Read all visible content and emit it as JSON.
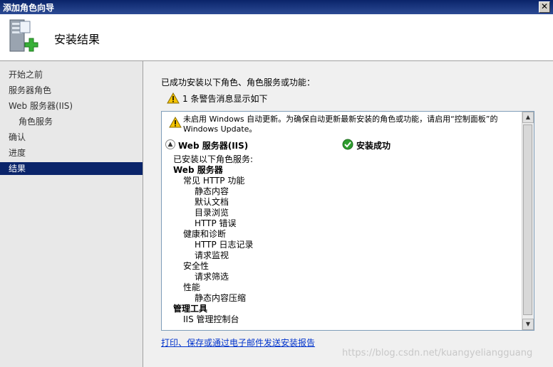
{
  "window": {
    "title": "添加角色向导",
    "close_glyph": "✕"
  },
  "header": {
    "title": "安装结果",
    "icon": "server-add-icon"
  },
  "sidebar": {
    "items": [
      {
        "label": "开始之前",
        "indent": 0,
        "selected": false
      },
      {
        "label": "服务器角色",
        "indent": 0,
        "selected": false
      },
      {
        "label": "Web 服务器(IIS)",
        "indent": 0,
        "selected": false
      },
      {
        "label": "角色服务",
        "indent": 1,
        "selected": false
      },
      {
        "label": "确认",
        "indent": 0,
        "selected": false
      },
      {
        "label": "进度",
        "indent": 0,
        "selected": false
      },
      {
        "label": "结果",
        "indent": 0,
        "selected": true
      }
    ]
  },
  "main": {
    "summary": "已成功安装以下角色、角色服务或功能：",
    "warning_count_text": "1 条警告消息显示如下",
    "results": {
      "note_text": "未启用 Windows 自动更新。为确保自动更新最新安装的角色或功能，请启用“控制面板”的 Windows Update。",
      "section_name": "Web 服务器(IIS)",
      "section_status": "安装成功",
      "tree": [
        {
          "text": "已安装以下角色服务:",
          "level": 0,
          "bold": false
        },
        {
          "text": "Web 服务器",
          "level": 0,
          "bold": true
        },
        {
          "text": "常见 HTTP 功能",
          "level": 1,
          "bold": false
        },
        {
          "text": "静态内容",
          "level": 2,
          "bold": false
        },
        {
          "text": "默认文档",
          "level": 2,
          "bold": false
        },
        {
          "text": "目录浏览",
          "level": 2,
          "bold": false
        },
        {
          "text": "HTTP 错误",
          "level": 2,
          "bold": false
        },
        {
          "text": "健康和诊断",
          "level": 1,
          "bold": false
        },
        {
          "text": "HTTP 日志记录",
          "level": 2,
          "bold": false
        },
        {
          "text": "请求监视",
          "level": 2,
          "bold": false
        },
        {
          "text": "安全性",
          "level": 1,
          "bold": false
        },
        {
          "text": "请求筛选",
          "level": 2,
          "bold": false
        },
        {
          "text": "性能",
          "level": 1,
          "bold": false
        },
        {
          "text": "静态内容压缩",
          "level": 2,
          "bold": false
        },
        {
          "text": "管理工具",
          "level": 0,
          "bold": true
        },
        {
          "text": "IIS 管理控制台",
          "level": 1,
          "bold": false
        }
      ]
    },
    "report_link": "打印、保存或通过电子邮件发送安装报告"
  },
  "watermark": "https://blog.csdn.net/kuangyeliangguang",
  "colors": {
    "title_bar": "#0a246a",
    "selected": "#0a246a",
    "link": "#0033cc",
    "warning": "#f5c400",
    "success": "#2e9d2e"
  }
}
